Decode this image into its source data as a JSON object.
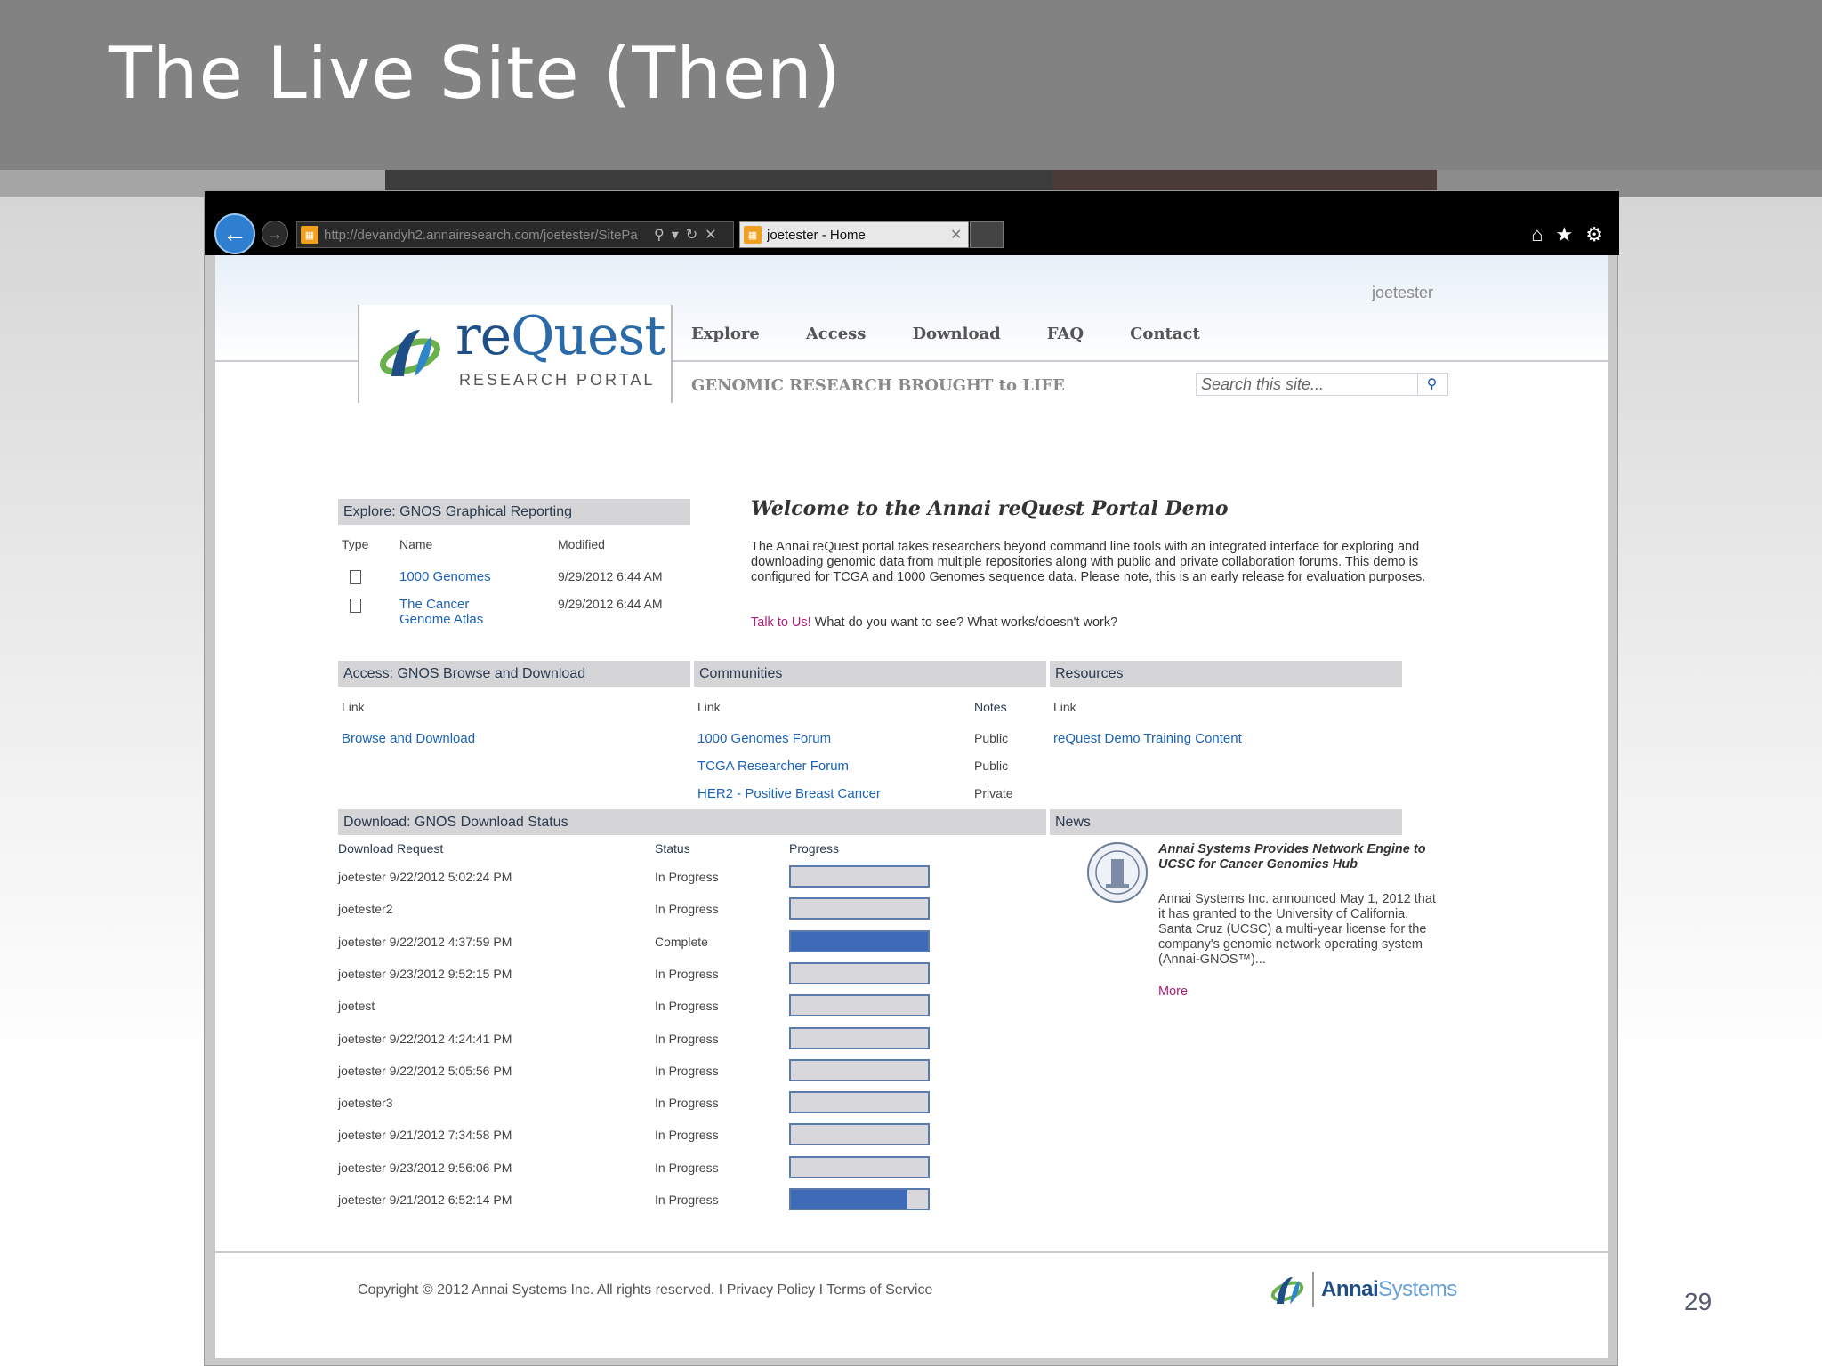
{
  "slide": {
    "title": "The Live Site (Then)",
    "page_number": "29"
  },
  "browser": {
    "url": "http://devandyh2.annairesearch.com/joetester/SitePa",
    "tab_title": "joetester - Home"
  },
  "site": {
    "user": "joetester",
    "logo": {
      "word_a": "re",
      "word_b": "Quest",
      "sub": "RESEARCH PORTAL"
    },
    "nav": [
      "Explore",
      "Access",
      "Download",
      "FAQ",
      "Contact"
    ],
    "tagline": "GENOMIC RESEARCH BROUGHT to LIFE",
    "search_placeholder": "Search this site..."
  },
  "explore": {
    "heading": "Explore: GNOS Graphical Reporting",
    "col_type": "Type",
    "col_name": "Name",
    "col_modified": "Modified",
    "rows": [
      {
        "name": "1000 Genomes",
        "modified": "9/29/2012 6:44 AM"
      },
      {
        "name_line1": "The Cancer",
        "name_line2": "Genome Atlas",
        "modified": "9/29/2012 6:44 AM"
      }
    ]
  },
  "welcome": {
    "title": "Welcome to the Annai reQuest Portal Demo",
    "body": "The Annai reQuest portal takes researchers beyond command line tools with an integrated interface for exploring and downloading genomic data from multiple repositories along with public and private collaboration forums. This demo is configured for TCGA and 1000 Genomes sequence data. Please note, this is an early release for evaluation purposes.",
    "talk_link": "Talk to Us!",
    "talk_rest": " What do you want to see? What works/doesn't work?"
  },
  "access": {
    "heading": "Access: GNOS Browse and Download",
    "col_link": "Link",
    "link": "Browse and Download"
  },
  "communities": {
    "heading": "Communities",
    "col_link": "Link",
    "col_notes": "Notes",
    "rows": [
      {
        "link": "1000 Genomes Forum",
        "note": "Public"
      },
      {
        "link": "TCGA Researcher Forum",
        "note": "Public"
      },
      {
        "link": "HER2 - Positive Breast Cancer",
        "note": "Private"
      }
    ]
  },
  "resources": {
    "heading": "Resources",
    "col_link": "Link",
    "link": "reQuest Demo Training Content"
  },
  "download": {
    "heading": "Download: GNOS Download Status",
    "col_request": "Download Request",
    "col_status": "Status",
    "col_progress": "Progress",
    "rows": [
      {
        "request": "joetester 9/22/2012 5:02:24 PM",
        "status": "In Progress",
        "progress": 0
      },
      {
        "request": "joetester2",
        "status": "In Progress",
        "progress": 0
      },
      {
        "request": "joetester 9/22/2012 4:37:59 PM",
        "status": "Complete",
        "progress": 1
      },
      {
        "request": "joetester 9/23/2012 9:52:15 PM",
        "status": "In Progress",
        "progress": 0
      },
      {
        "request": "joetest",
        "status": "In Progress",
        "progress": 0
      },
      {
        "request": "joetester 9/22/2012 4:24:41 PM",
        "status": "In Progress",
        "progress": 0
      },
      {
        "request": "joetester 9/22/2012 5:05:56 PM",
        "status": "In Progress",
        "progress": 0
      },
      {
        "request": "joetester3",
        "status": "In Progress",
        "progress": 0
      },
      {
        "request": "joetester 9/21/2012 7:34:58 PM",
        "status": "In Progress",
        "progress": 0
      },
      {
        "request": "joetester 9/23/2012 9:56:06 PM",
        "status": "In Progress",
        "progress": 0
      },
      {
        "request": "joetester 9/21/2012 6:52:14 PM",
        "status": "In Progress",
        "progress": 0.85
      }
    ]
  },
  "news": {
    "heading": "News",
    "title": "Annai Systems Provides Network Engine to UCSC for Cancer Genomics Hub",
    "body": "Annai Systems Inc. announced May 1, 2012 that it has granted to the University of California, Santa Cruz (UCSC) a multi-year license for the company's genomic network operating system (Annai-GNOS™)...",
    "more": "More"
  },
  "footer": {
    "copyright": "Copyright © 2012 Annai Systems Inc. All rights reserved.  I  Privacy Policy  I  Terms of Service",
    "brand_a": "Annai",
    "brand_b": "Systems"
  }
}
